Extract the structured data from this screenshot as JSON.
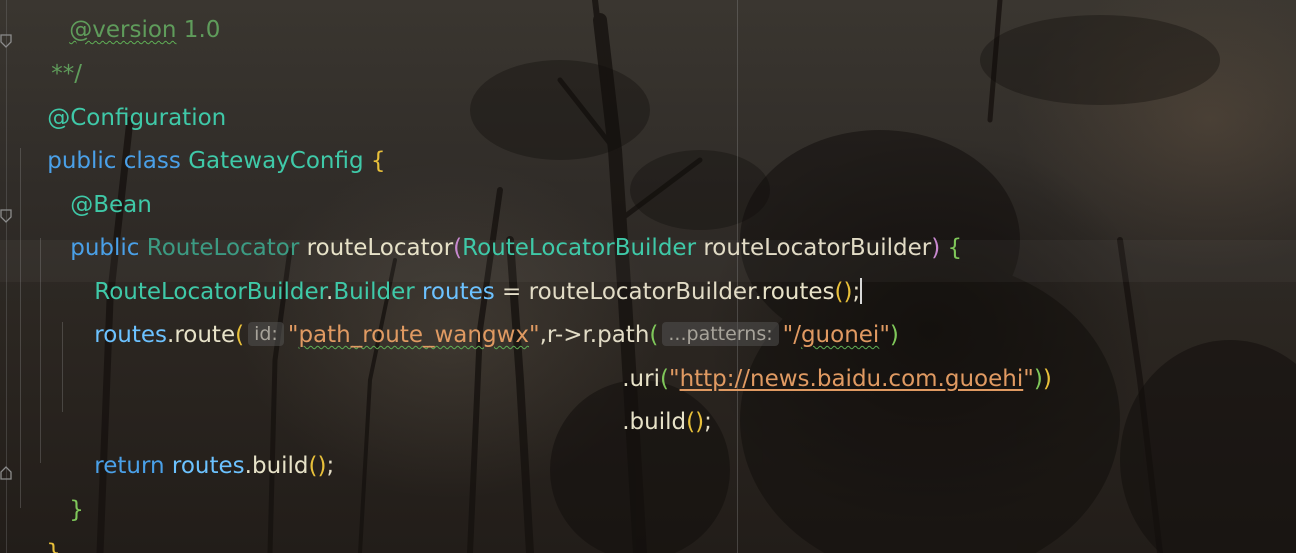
{
  "editor": {
    "language": "java",
    "lines": {
      "version": {
        "tag": "@version",
        "value": " 1.0"
      },
      "doc_end": "**/",
      "ann_configuration": "@Configuration",
      "class_decl": {
        "kw_public": "public",
        "kw_class": "class",
        "name": "GatewayConfig",
        "brace_open": "{"
      },
      "ann_bean": "@Bean",
      "method_decl": {
        "kw_public": "public",
        "return_type": "RouteLocator",
        "name": "routeLocator",
        "paren_open": "(",
        "param_type": "RouteLocatorBuilder",
        "param_name": "routeLocatorBuilder",
        "paren_close": ")",
        "brace_open": "{"
      },
      "builder_line": {
        "type": "RouteLocatorBuilder",
        "dot": ".",
        "inner": "Builder",
        "var": "routes",
        "assign": " = ",
        "target": "routeLocatorBuilder",
        "call": ".routes",
        "parens": "()",
        "semi": ";"
      },
      "route_line": {
        "var": "routes",
        "call": ".route",
        "paren_open": "(",
        "hint_id": "id:",
        "q1": "\"",
        "id_value": "path_route_wangwx",
        "q2": "\"",
        "lambda": ",r->r.path",
        "paren2_open": "(",
        "hint_patterns": "...patterns:",
        "path_q1": "\"/",
        "path_value": "guonei",
        "path_q2": "\"",
        "paren2_close": ")"
      },
      "uri_line": {
        "call": ".uri",
        "paren_open": "(",
        "q1": "\"",
        "url": "http://news.baidu.com.guoehi",
        "q2": "\"",
        "paren_close": ")",
        "outer_close": ")"
      },
      "build_line": {
        "call": ".build",
        "parens": "()",
        "semi": ";"
      },
      "return_line": {
        "kw": "return",
        "var": "routes",
        "call": ".build",
        "parens": "()",
        "semi": ";"
      },
      "method_close": "}",
      "class_close": "}"
    }
  },
  "colors": {
    "annotation": "#3fc9a8",
    "keyword": "#4aa0e8",
    "string": "#e09a62",
    "doc_comment": "#5f9c5b",
    "bracket_yellow": "#e8c03a"
  }
}
